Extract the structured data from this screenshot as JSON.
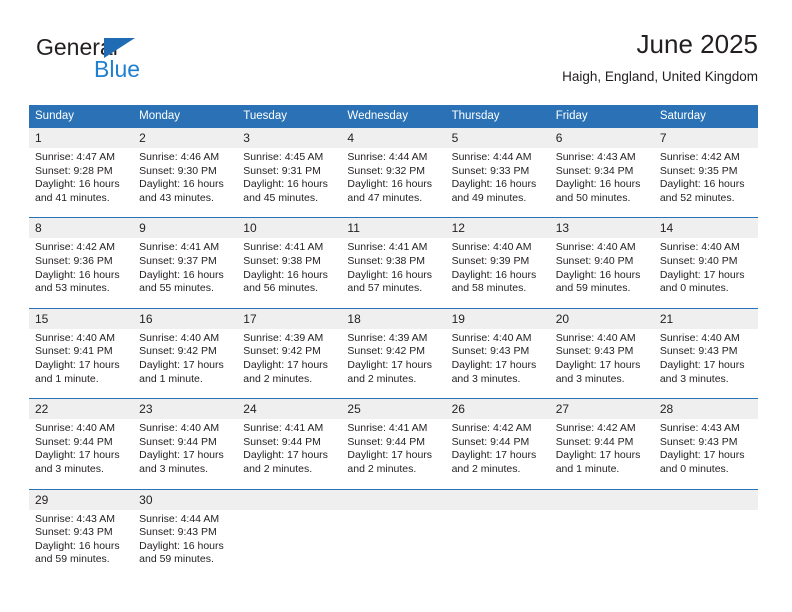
{
  "brand": {
    "name_top": "General",
    "name_bottom": "Blue",
    "triangle_icon": "blue-triangle-logo-icon"
  },
  "header": {
    "title": "June 2025",
    "subtitle": "Haigh, England, United Kingdom"
  },
  "colors": {
    "header_blue": "#2a72b5",
    "brand_blue": "#1f7fd0",
    "daynum_band": "#efefef",
    "text": "#231f20"
  },
  "calendar": {
    "weekday_headers": [
      "Sunday",
      "Monday",
      "Tuesday",
      "Wednesday",
      "Thursday",
      "Friday",
      "Saturday"
    ],
    "weeks": [
      [
        {
          "day": "1",
          "sunrise": "Sunrise: 4:47 AM",
          "sunset": "Sunset: 9:28 PM",
          "daylight1": "Daylight: 16 hours",
          "daylight2": "and 41 minutes."
        },
        {
          "day": "2",
          "sunrise": "Sunrise: 4:46 AM",
          "sunset": "Sunset: 9:30 PM",
          "daylight1": "Daylight: 16 hours",
          "daylight2": "and 43 minutes."
        },
        {
          "day": "3",
          "sunrise": "Sunrise: 4:45 AM",
          "sunset": "Sunset: 9:31 PM",
          "daylight1": "Daylight: 16 hours",
          "daylight2": "and 45 minutes."
        },
        {
          "day": "4",
          "sunrise": "Sunrise: 4:44 AM",
          "sunset": "Sunset: 9:32 PM",
          "daylight1": "Daylight: 16 hours",
          "daylight2": "and 47 minutes."
        },
        {
          "day": "5",
          "sunrise": "Sunrise: 4:44 AM",
          "sunset": "Sunset: 9:33 PM",
          "daylight1": "Daylight: 16 hours",
          "daylight2": "and 49 minutes."
        },
        {
          "day": "6",
          "sunrise": "Sunrise: 4:43 AM",
          "sunset": "Sunset: 9:34 PM",
          "daylight1": "Daylight: 16 hours",
          "daylight2": "and 50 minutes."
        },
        {
          "day": "7",
          "sunrise": "Sunrise: 4:42 AM",
          "sunset": "Sunset: 9:35 PM",
          "daylight1": "Daylight: 16 hours",
          "daylight2": "and 52 minutes."
        }
      ],
      [
        {
          "day": "8",
          "sunrise": "Sunrise: 4:42 AM",
          "sunset": "Sunset: 9:36 PM",
          "daylight1": "Daylight: 16 hours",
          "daylight2": "and 53 minutes."
        },
        {
          "day": "9",
          "sunrise": "Sunrise: 4:41 AM",
          "sunset": "Sunset: 9:37 PM",
          "daylight1": "Daylight: 16 hours",
          "daylight2": "and 55 minutes."
        },
        {
          "day": "10",
          "sunrise": "Sunrise: 4:41 AM",
          "sunset": "Sunset: 9:38 PM",
          "daylight1": "Daylight: 16 hours",
          "daylight2": "and 56 minutes."
        },
        {
          "day": "11",
          "sunrise": "Sunrise: 4:41 AM",
          "sunset": "Sunset: 9:38 PM",
          "daylight1": "Daylight: 16 hours",
          "daylight2": "and 57 minutes."
        },
        {
          "day": "12",
          "sunrise": "Sunrise: 4:40 AM",
          "sunset": "Sunset: 9:39 PM",
          "daylight1": "Daylight: 16 hours",
          "daylight2": "and 58 minutes."
        },
        {
          "day": "13",
          "sunrise": "Sunrise: 4:40 AM",
          "sunset": "Sunset: 9:40 PM",
          "daylight1": "Daylight: 16 hours",
          "daylight2": "and 59 minutes."
        },
        {
          "day": "14",
          "sunrise": "Sunrise: 4:40 AM",
          "sunset": "Sunset: 9:40 PM",
          "daylight1": "Daylight: 17 hours",
          "daylight2": "and 0 minutes."
        }
      ],
      [
        {
          "day": "15",
          "sunrise": "Sunrise: 4:40 AM",
          "sunset": "Sunset: 9:41 PM",
          "daylight1": "Daylight: 17 hours",
          "daylight2": "and 1 minute."
        },
        {
          "day": "16",
          "sunrise": "Sunrise: 4:40 AM",
          "sunset": "Sunset: 9:42 PM",
          "daylight1": "Daylight: 17 hours",
          "daylight2": "and 1 minute."
        },
        {
          "day": "17",
          "sunrise": "Sunrise: 4:39 AM",
          "sunset": "Sunset: 9:42 PM",
          "daylight1": "Daylight: 17 hours",
          "daylight2": "and 2 minutes."
        },
        {
          "day": "18",
          "sunrise": "Sunrise: 4:39 AM",
          "sunset": "Sunset: 9:42 PM",
          "daylight1": "Daylight: 17 hours",
          "daylight2": "and 2 minutes."
        },
        {
          "day": "19",
          "sunrise": "Sunrise: 4:40 AM",
          "sunset": "Sunset: 9:43 PM",
          "daylight1": "Daylight: 17 hours",
          "daylight2": "and 3 minutes."
        },
        {
          "day": "20",
          "sunrise": "Sunrise: 4:40 AM",
          "sunset": "Sunset: 9:43 PM",
          "daylight1": "Daylight: 17 hours",
          "daylight2": "and 3 minutes."
        },
        {
          "day": "21",
          "sunrise": "Sunrise: 4:40 AM",
          "sunset": "Sunset: 9:43 PM",
          "daylight1": "Daylight: 17 hours",
          "daylight2": "and 3 minutes."
        }
      ],
      [
        {
          "day": "22",
          "sunrise": "Sunrise: 4:40 AM",
          "sunset": "Sunset: 9:44 PM",
          "daylight1": "Daylight: 17 hours",
          "daylight2": "and 3 minutes."
        },
        {
          "day": "23",
          "sunrise": "Sunrise: 4:40 AM",
          "sunset": "Sunset: 9:44 PM",
          "daylight1": "Daylight: 17 hours",
          "daylight2": "and 3 minutes."
        },
        {
          "day": "24",
          "sunrise": "Sunrise: 4:41 AM",
          "sunset": "Sunset: 9:44 PM",
          "daylight1": "Daylight: 17 hours",
          "daylight2": "and 2 minutes."
        },
        {
          "day": "25",
          "sunrise": "Sunrise: 4:41 AM",
          "sunset": "Sunset: 9:44 PM",
          "daylight1": "Daylight: 17 hours",
          "daylight2": "and 2 minutes."
        },
        {
          "day": "26",
          "sunrise": "Sunrise: 4:42 AM",
          "sunset": "Sunset: 9:44 PM",
          "daylight1": "Daylight: 17 hours",
          "daylight2": "and 2 minutes."
        },
        {
          "day": "27",
          "sunrise": "Sunrise: 4:42 AM",
          "sunset": "Sunset: 9:44 PM",
          "daylight1": "Daylight: 17 hours",
          "daylight2": "and 1 minute."
        },
        {
          "day": "28",
          "sunrise": "Sunrise: 4:43 AM",
          "sunset": "Sunset: 9:43 PM",
          "daylight1": "Daylight: 17 hours",
          "daylight2": "and 0 minutes."
        }
      ],
      [
        {
          "day": "29",
          "sunrise": "Sunrise: 4:43 AM",
          "sunset": "Sunset: 9:43 PM",
          "daylight1": "Daylight: 16 hours",
          "daylight2": "and 59 minutes."
        },
        {
          "day": "30",
          "sunrise": "Sunrise: 4:44 AM",
          "sunset": "Sunset: 9:43 PM",
          "daylight1": "Daylight: 16 hours",
          "daylight2": "and 59 minutes."
        },
        {
          "day": "",
          "sunrise": "",
          "sunset": "",
          "daylight1": "",
          "daylight2": ""
        },
        {
          "day": "",
          "sunrise": "",
          "sunset": "",
          "daylight1": "",
          "daylight2": ""
        },
        {
          "day": "",
          "sunrise": "",
          "sunset": "",
          "daylight1": "",
          "daylight2": ""
        },
        {
          "day": "",
          "sunrise": "",
          "sunset": "",
          "daylight1": "",
          "daylight2": ""
        },
        {
          "day": "",
          "sunrise": "",
          "sunset": "",
          "daylight1": "",
          "daylight2": ""
        }
      ]
    ]
  }
}
